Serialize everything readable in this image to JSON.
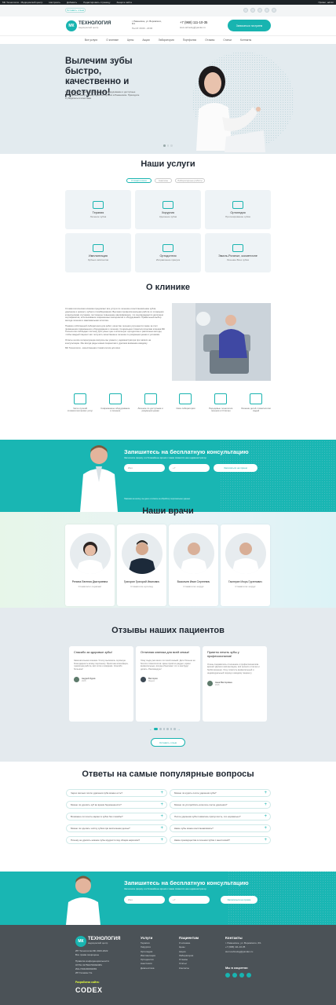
{
  "adminbar": {
    "items": [
      "МК Технология - Медицинский центр",
      "Настроить",
      "2",
      "0",
      "Добавить",
      "Редактировать страницу",
      "Защита сайта"
    ],
    "right": "Привет, admin"
  },
  "topstrip": {
    "pill_label": "Оставить отзыв"
  },
  "header": {
    "logo_mark": "МК",
    "logo_title": "ТЕХНОЛОГИЯ",
    "logo_sub": "медицинский центр",
    "address": "г. Раменское, ул. Воровского, 6/1",
    "hours": "Пн-Сб: 09:00 - 20:00",
    "phone": "+7 (968) 111-10-35",
    "email": "stom-tehnolog@yandex.ru",
    "cta": "Записаться на прием"
  },
  "nav": [
    "Все услуги",
    "О клинике",
    "Цены",
    "Акции",
    "Лаборатория",
    "Портфолио",
    "Отзывы",
    "Статьи",
    "Контакты"
  ],
  "hero": {
    "title": "Вылечим зубы быстро, качественно и доступно!",
    "text": "Отличный опыт доктора, современное оборудование и доступные цены делают нашу клинику одной из лучших в Раменском. Приходите и убедитесь в этом сами."
  },
  "services": {
    "title": "Наши услуги",
    "tabs": [
      "Стоматология",
      "Анализы",
      "Лабораторные работы"
    ],
    "items": [
      {
        "title": "Терапия",
        "sub": "Лечение зубов"
      },
      {
        "title": "Хирургия",
        "sub": "Удаление зубов"
      },
      {
        "title": "Ортопедия",
        "sub": "Протезирование зубов"
      },
      {
        "title": "Имплантация",
        "sub": "Зубных имплантов"
      },
      {
        "title": "Ортодонтия",
        "sub": "Исправление прикуса"
      },
      {
        "title": "Эмаль-Рогатые, косметичне",
        "sub": "Лечение Всех зубов"
      }
    ]
  },
  "about": {
    "title": "О клинике",
    "p1": "Стоматологическая клиника предлагает все услуги по лечению и восстановлению зубов, удалению и ремонту зубного пломбирования. Высокая профессиональная работа со сложными клиническими случаями, постоянное повышение квалификации, что подтверждается наличием сертификатов, использование современных материалов и оборудования. Правильный выбор метода лечения и максимальная эстетика.",
    "p2": "Помимо собственной лаборатории для работ, качество лечения улучшается также за счёт применения современного оборудования и лечения. Социальная стоматологическая клиника МК Технология соблюдает систему доступных цен и использует ортодонтию и различные методы, чтобы каждый пациент мог получить качественное лечение по разумным ценам и условиям.",
    "p3": "Ответы на все интересующие вопросы вы узнаете у администратора при записи на консультацию. Мы всегда рады новым пациентам и уделяем внимание каждому.",
    "p4": "МК Технология - качественная стоматология для всех",
    "features": [
      "Четко лучший стоматологических услуг",
      "Современное оборудование и лечение",
      "Лечение по доступным и разумным ценам",
      "Своя лаборатория",
      "Передовые технологии лечения и Отлично",
      "Лечение детей стоматологии людей"
    ]
  },
  "consult": {
    "title": "Запишитесь на бесплатную консультацию",
    "sub": "Заполните форму и в ближайшее время с вами свяжется наш администратор",
    "name_ph": "Имя",
    "phone_ph": "+7",
    "button": "Записаться на прием",
    "note": "Нажимая на кнопку, вы даете согласие на обработку персональных данных"
  },
  "doctors": {
    "title": "Наши врачи",
    "items": [
      {
        "name": "Репина Евгения Дмитриевна",
        "role": "Стоматолог-терапевт"
      },
      {
        "name": "Григорян Григорий Иванович",
        "role": "Стоматолог-ортопед"
      },
      {
        "name": "Васильев Иван Сергеевич",
        "role": "Стоматолог-хирург"
      },
      {
        "name": "Гасперян Игорь Гургенович",
        "role": "Стоматолог-хирург"
      }
    ]
  },
  "reviews": {
    "title": "Отзывы наших пациентов",
    "items": [
      {
        "q": "Спасибо за здоровые зубы!",
        "b": "Замечательная клиника. Я хочу высказать огромную благодарность всему персоналу. Приятная атмосфера, грамотная работа, всё чётко и вовремя. Спасибо большое!",
        "author": "Андрей Зуров",
        "source": "2GIS"
      },
      {
        "q": "Отличная клиника для всей семьи!",
        "b": "Хожу сюда уже много лет всей семьёй. Дети больше не боятся стоматологов. Цены приятно радуют, врачи внимательные, всегда объясняют что и как будут делать. Рекомендую!",
        "author": "Виктория",
        "source": "Яндекс"
      },
      {
        "q": "Приятно лечить зубы у профессионалов!",
        "b": "Очень понравилось отношение и профессионализм врачей. Делали имплантацию, всё прошло отлично и безболезненно. Хочу отметить внимательный и индивидуальный подход к каждому пациенту.",
        "author": "Анна Викторовна",
        "source": "2GIS"
      }
    ],
    "button": "Оставить отзыв"
  },
  "faq": {
    "title": "Ответы на самые популярные вопросы",
    "left": [
      "Через сколько после удаления зуба можно есть?",
      "Можно ли удалить зуб во время беременности?",
      "Возможно ли лечить кариес в зубах без пломбы?",
      "Можно ли сделать чистку зубов при воспалении десны?",
      "Почему не удалить нижние зубы мудрости под общим наркозом?"
    ],
    "right": [
      "Можно ли курить после удаления зуба?",
      "Можно ли употреблять алкоголь после удаления?",
      "После удаления зуба появилась припухлость, это нормально?",
      "Какие зубы можно восстанавливать?",
      "Какие преимущества в лечении зубов с анестезией?"
    ]
  },
  "consult2": {
    "title": "Запишитесь на бесплатную консультацию",
    "sub": "Заполните форму и в ближайшее время с вами свяжется наш администратор",
    "name_ph": "Имя",
    "phone_ph": "+7",
    "button": "Записаться на прием"
  },
  "footer": {
    "logo_mark": "МК",
    "logo_title": "ТЕХНОЛОГИЯ",
    "logo_sub": "медицинский центр",
    "info": [
      "ИП Технология-МК 2020-2022",
      "Все права защищены",
      "Правила конфиденциальности",
      "ОГРН 317502700032081",
      "ИНН 504200092081",
      "ИП Гегамян Г.Е."
    ],
    "dev_label": "Разработка сайта:",
    "dev": "CODEX",
    "col1_title": "Услуги",
    "col1": [
      "Терапия",
      "Хирургия",
      "Ортопедия",
      "Имплантация",
      "Ортодонтия",
      "Анестезия",
      "Диагностика"
    ],
    "col2_title": "Пациентам",
    "col2": [
      "О клинике",
      "Цены",
      "Акции",
      "Лаборатория",
      "Отзывы",
      "Статьи",
      "Контакты"
    ],
    "col3_title": "Контакты",
    "col3": [
      "г. Раменское, ул. Воровского, 6/1",
      "+7 (968) 111-10-35",
      "stom-tehnolog@yandex.ru"
    ],
    "social_title": "Мы в соцсетях:"
  }
}
